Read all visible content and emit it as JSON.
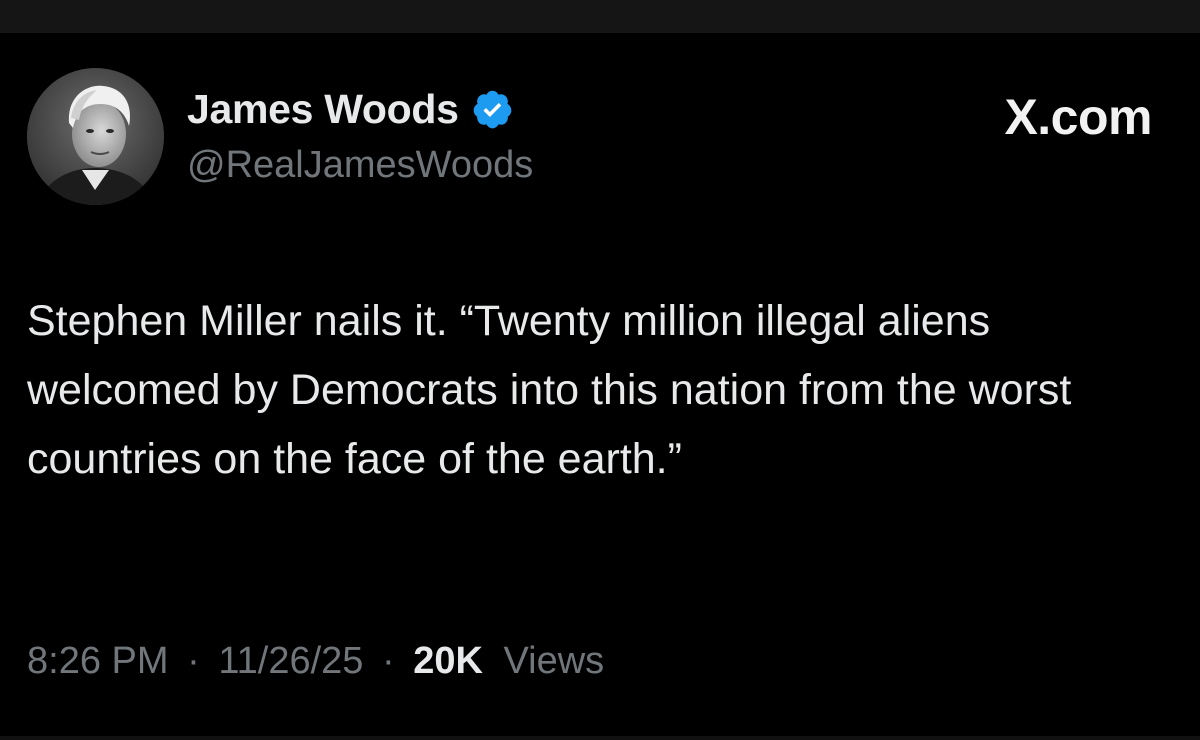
{
  "tweet": {
    "author": {
      "display_name": "James Woods",
      "handle": "@RealJamesWoods",
      "verified": true,
      "avatar": "grayscale-portrait"
    },
    "source_logo": "X.com",
    "text": "Stephen Miller nails it. “Twenty million illegal aliens welcomed by Democrats into this nation from the worst countries on the face of the earth.”",
    "time": "8:26 PM",
    "date": "11/26/25",
    "separator": "·",
    "views_count": "20K",
    "views_label": "Views"
  },
  "colors": {
    "background": "#000000",
    "primary_text": "#e7e9ea",
    "secondary_text": "#71767b",
    "verified_blue": "#1d9bf0"
  }
}
